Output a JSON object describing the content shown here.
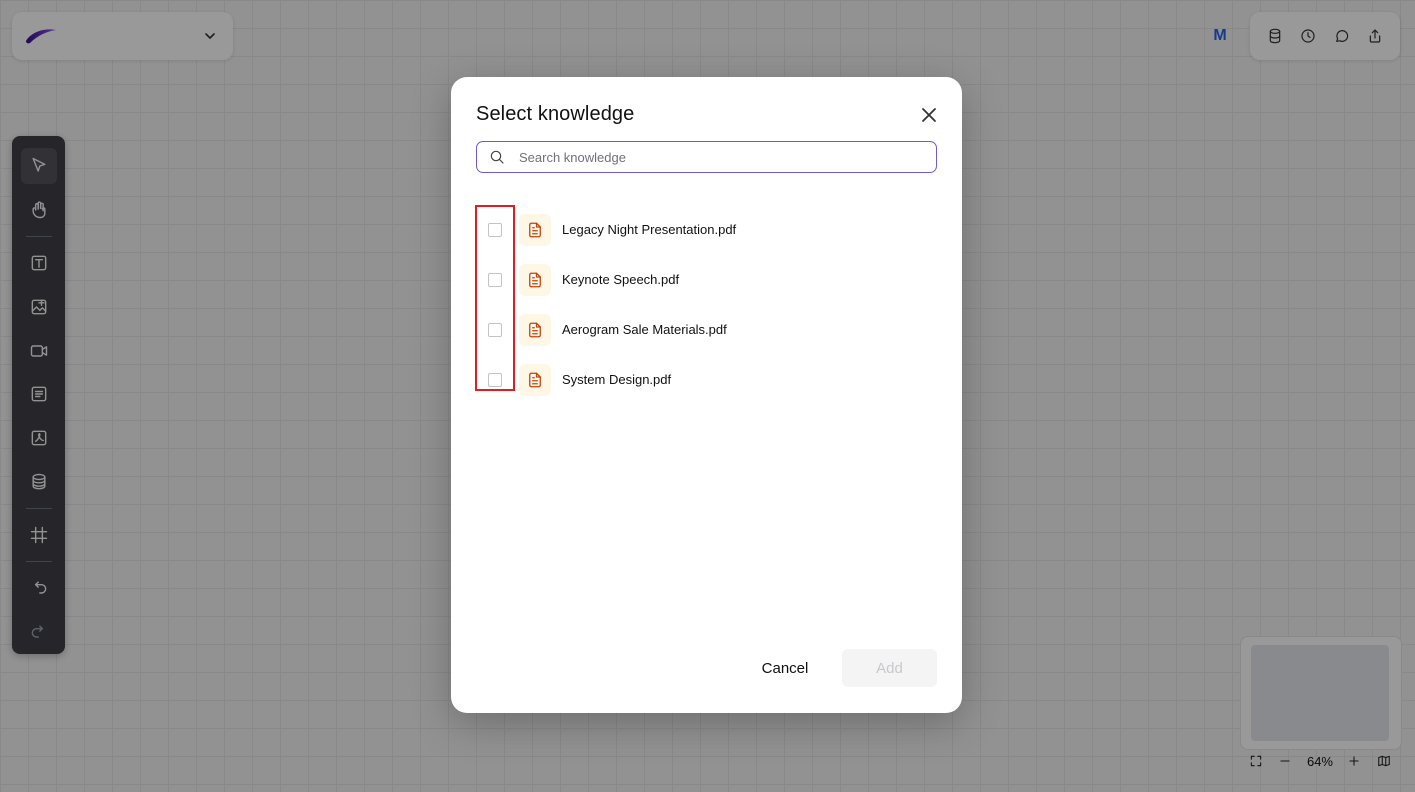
{
  "topbar": {
    "workspace_logo_icon": "swoosh-logo-icon",
    "workspace_menu_icon": "chevron-down-icon",
    "user_avatar_initial": "M",
    "actions": [
      {
        "name": "database-icon"
      },
      {
        "name": "history-icon"
      },
      {
        "name": "comment-icon"
      },
      {
        "name": "share-icon"
      }
    ]
  },
  "toolbar": {
    "tools": [
      "select-pointer-icon",
      "hand-pan-icon",
      "text-icon",
      "image-icon",
      "video-icon",
      "document-icon",
      "pdf-icon",
      "knowledge-base-icon",
      "frame-icon",
      "undo-icon",
      "redo-icon"
    ]
  },
  "zoom": {
    "level": "64%"
  },
  "modal": {
    "title": "Select knowledge",
    "search_placeholder": "Search knowledge",
    "search_value": "",
    "files": [
      {
        "name": "Legacy Night Presentation.pdf",
        "checked": false
      },
      {
        "name": "Keynote Speech.pdf",
        "checked": false
      },
      {
        "name": "Aerogram Sale Materials.pdf",
        "checked": false
      },
      {
        "name": "System Design.pdf",
        "checked": false
      }
    ],
    "cancel_label": "Cancel",
    "add_label": "Add"
  },
  "colors": {
    "accent": "#6d5bd0",
    "file_icon": "#c2410c",
    "highlight": "#e11d24",
    "avatar": "#2563eb"
  }
}
